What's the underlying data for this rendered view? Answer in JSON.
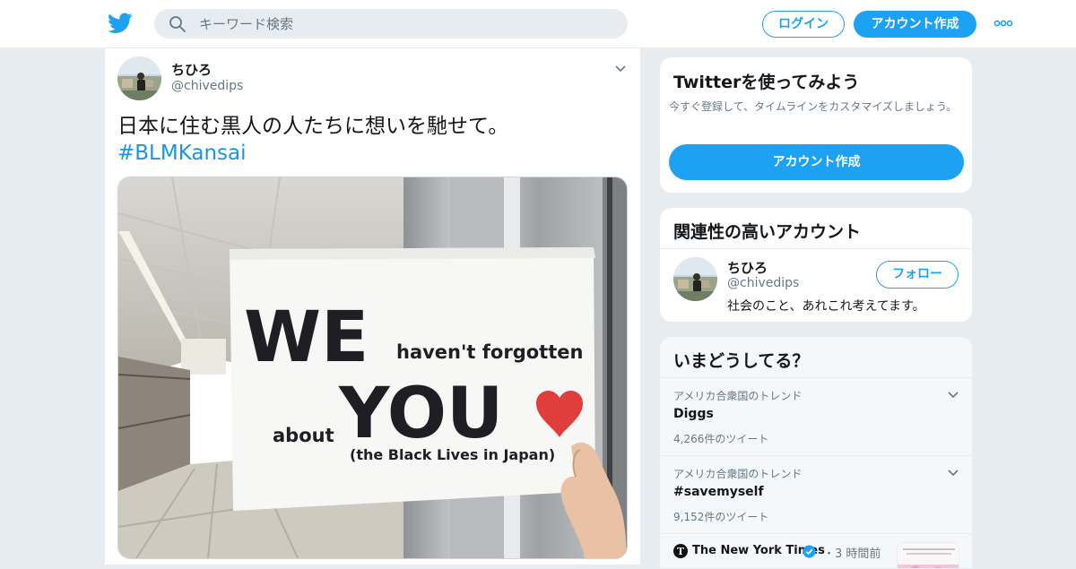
{
  "header": {
    "search_placeholder": "キーワード検索",
    "login_label": "ログイン",
    "signup_label": "アカウント作成"
  },
  "tweet": {
    "author_name": "ちひろ",
    "author_handle": "@chivedips",
    "text": "日本に住む黒人の人たちに想いを馳せて。",
    "hashtag": "#BLMKansai",
    "sign": {
      "we": "WE",
      "haventforgotten": "haven't  forgotten",
      "about": "about",
      "you": "YOU",
      "sub": "(the Black Lives in Japan)"
    }
  },
  "signup_card": {
    "title": "Twitterを使ってみよう",
    "description": "今すぐ登録して、タイムラインをカスタマイズしましょう。",
    "button_label": "アカウント作成"
  },
  "related_card": {
    "title": "関連性の高いアカウント",
    "name": "ちひろ",
    "handle": "@chivedips",
    "bio": "社会のこと、あれこれ考えてます。",
    "follow_label": "フォロー"
  },
  "trends_card": {
    "title": "いまどうしてる？",
    "trends": [
      {
        "context": "アメリカ合衆国のトレンド",
        "name": "Diggs",
        "count": "4,266件のツイート"
      },
      {
        "context": "アメリカ合衆国のトレンド",
        "name": "#savemyself",
        "count": "9,152件のツイート"
      }
    ],
    "news": {
      "source": "The New York Times",
      "separator": "・",
      "time": "3 時間前"
    }
  },
  "colors": {
    "brand": "#1da1f2",
    "link": "#1b95e0",
    "background": "#e6ecf0",
    "secondary_text": "#657786",
    "heart": "#e03d3d"
  },
  "icons": [
    "twitter-bird-logo",
    "search-icon",
    "more-dots-icon",
    "chevron-down-icon",
    "verified-badge-icon",
    "nyt-logo"
  ]
}
